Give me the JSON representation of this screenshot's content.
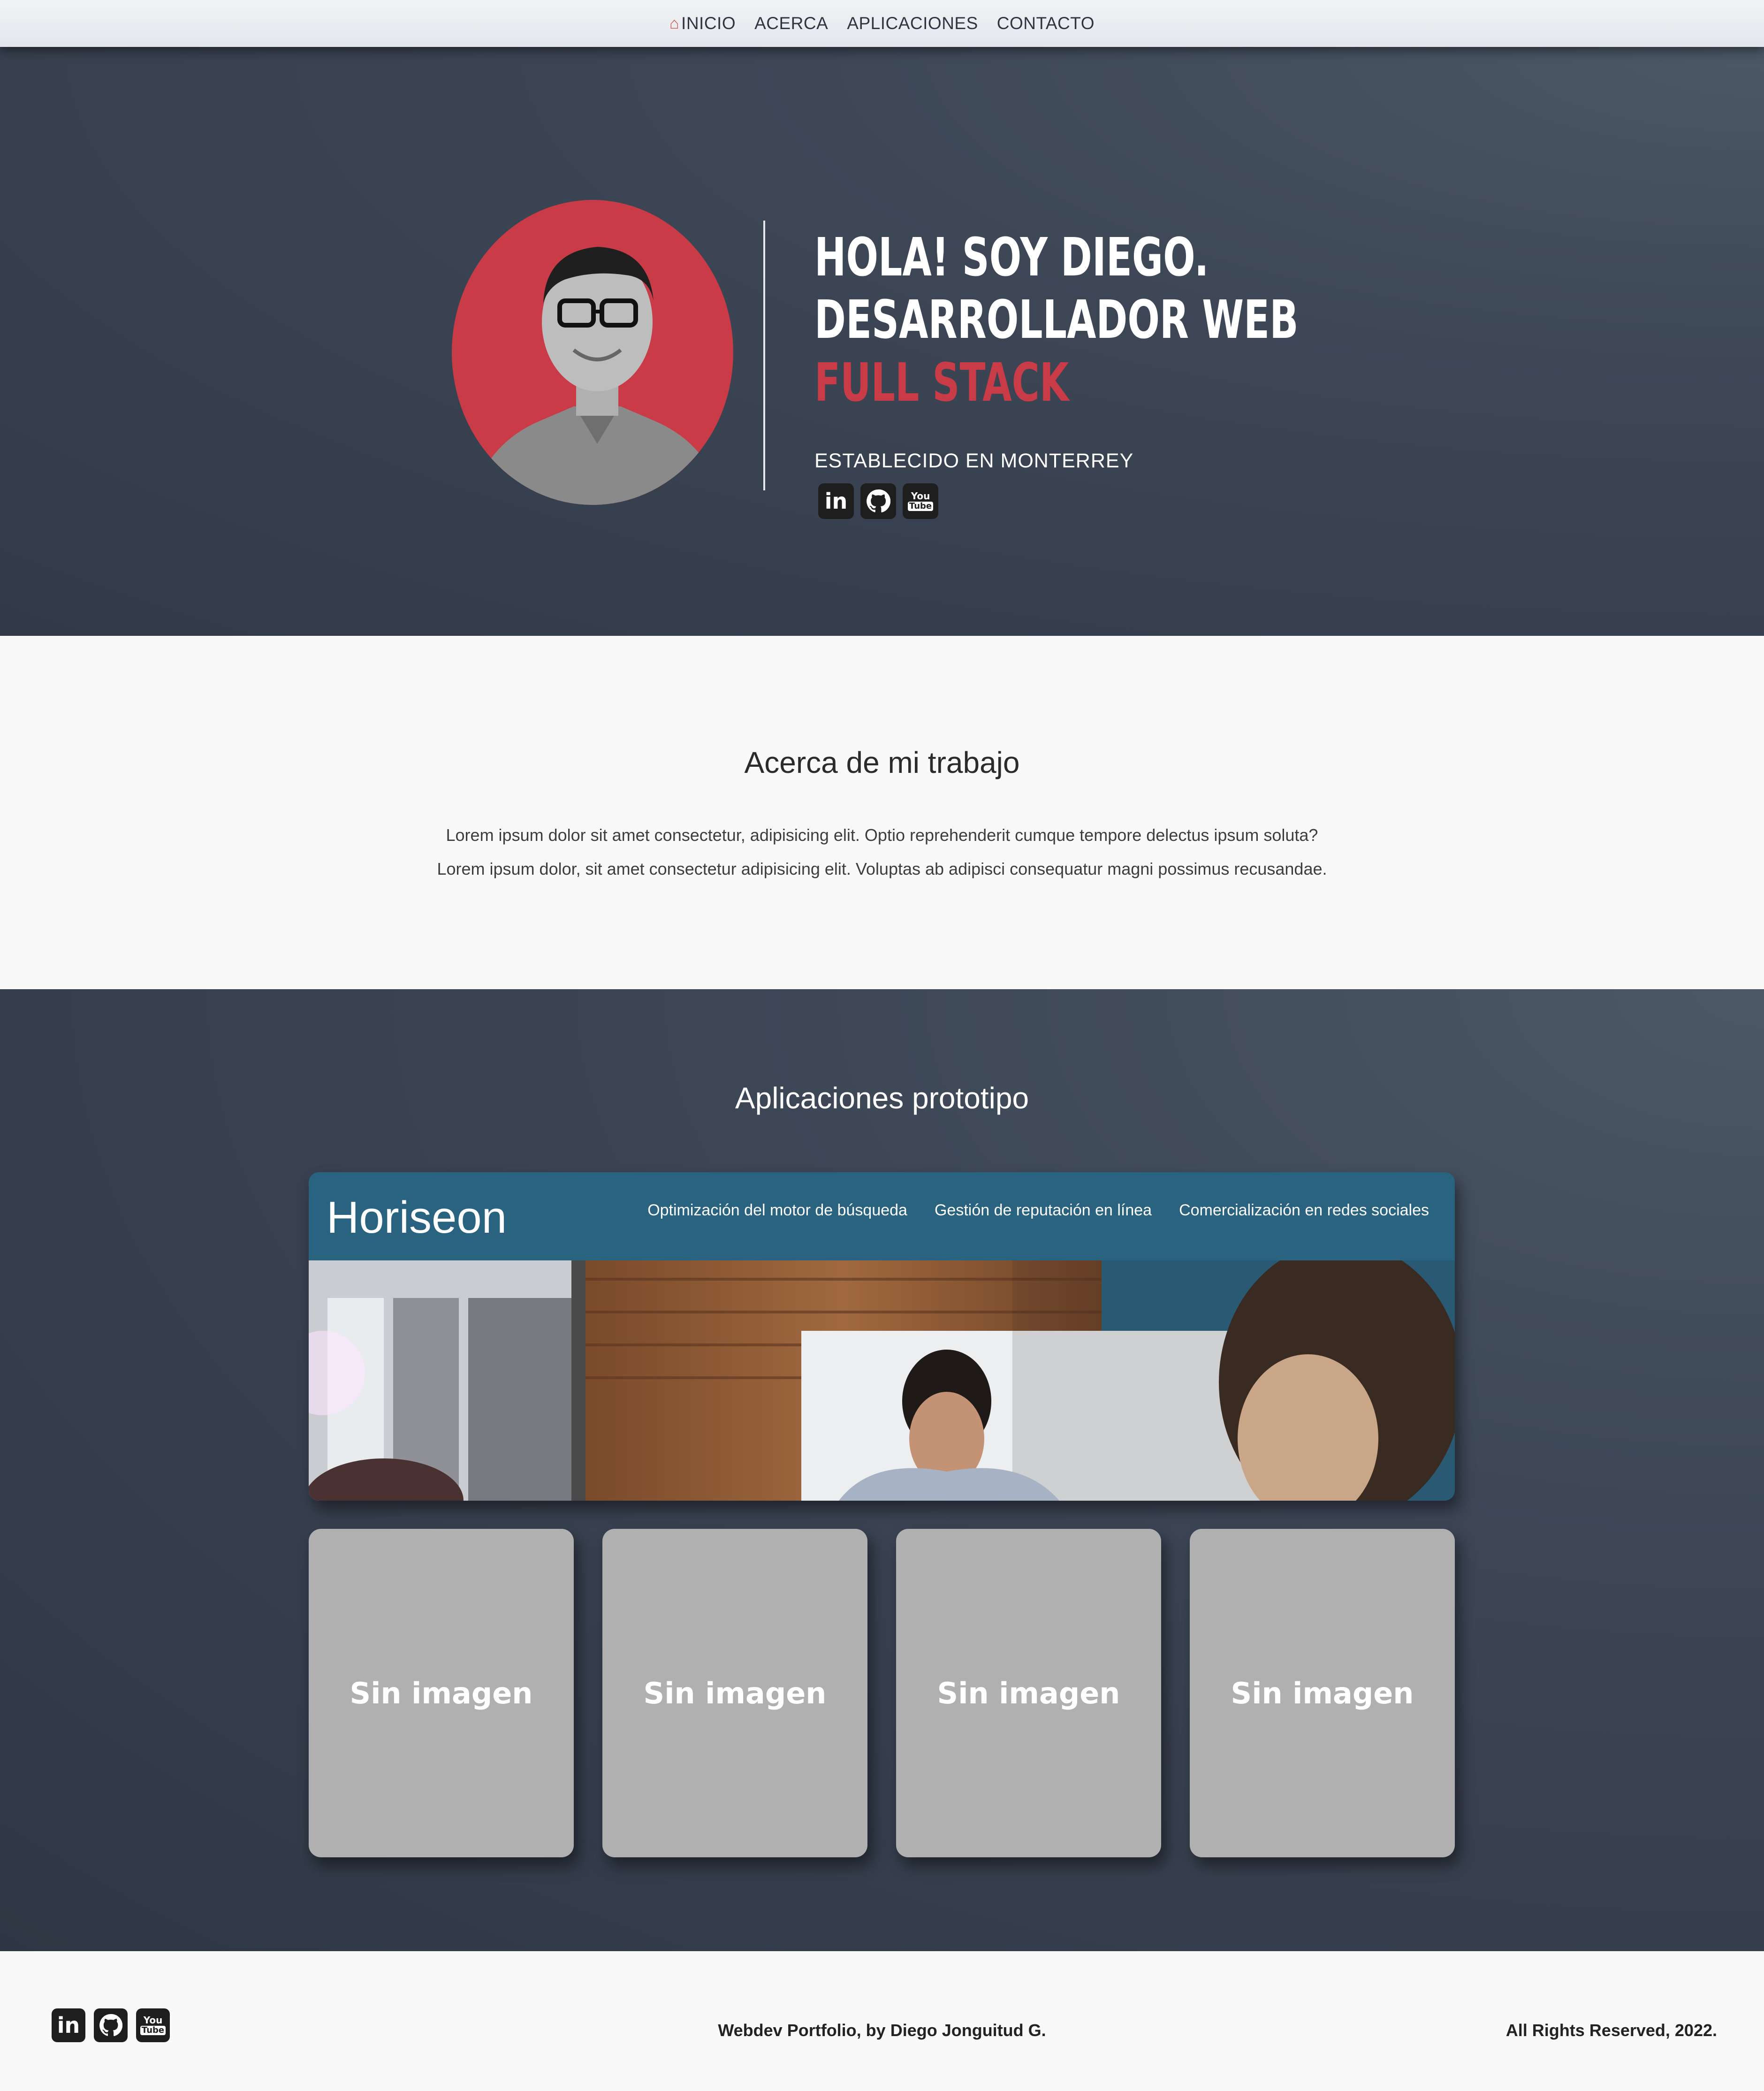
{
  "nav": {
    "home_icon": "house-icon",
    "items": [
      {
        "label": "INICIO"
      },
      {
        "label": "ACERCA"
      },
      {
        "label": "APLICACIONES"
      },
      {
        "label": "CONTACTO"
      }
    ]
  },
  "hero": {
    "line1": "HOLA! SOY DIEGO.",
    "line2": "DESARROLLADOR WEB",
    "line3": "FULL STACK",
    "location": "ESTABLECIDO EN MONTERREY",
    "accent_color": "#c93c47",
    "social": [
      {
        "icon": "linkedin-icon",
        "text": "in"
      },
      {
        "icon": "github-icon"
      },
      {
        "icon": "youtube-icon",
        "top": "You",
        "bottom": "Tube"
      }
    ]
  },
  "about": {
    "title": "Acerca de mi trabajo",
    "line1": "Lorem ipsum dolor sit amet consectetur, adipisicing elit. Optio reprehenderit cumque tempore delectus ipsum soluta?",
    "line2": "Lorem ipsum dolor, sit amet consectetur adipisicing elit. Voluptas ab adipisci consequatur magni possimus recusandae."
  },
  "apps": {
    "title": "Aplicaciones prototipo",
    "featured": {
      "logo": "Horiseon",
      "links": [
        "Optimización del motor de búsqueda",
        "Gestión de reputación en línea",
        "Comercialización en redes sociales"
      ]
    },
    "cards": [
      {
        "label": "Sin imagen"
      },
      {
        "label": "Sin imagen"
      },
      {
        "label": "Sin imagen"
      },
      {
        "label": "Sin imagen"
      }
    ]
  },
  "footer": {
    "credit": "Webdev Portfolio, by Diego Jonguitud G.",
    "rights": "All Rights Reserved, 2022."
  }
}
